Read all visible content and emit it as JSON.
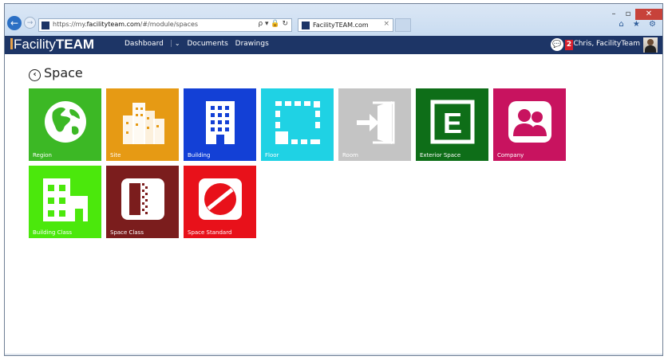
{
  "browser": {
    "url_prefix": "https://my.",
    "url_domain": "facilityteam.com",
    "url_path": "/#/module/spaces",
    "address_tools": "ρ ▾ 🔒 ↻",
    "tab_title": "FacilityTEAM.com",
    "tab_close": "×",
    "back_glyph": "←",
    "forward_glyph": "→",
    "minimize": "–",
    "maximize": "▫",
    "close": "✕",
    "right_icons": "⌂ ★ ⚙"
  },
  "header": {
    "logo_thin": "Facility",
    "logo_bold": "TEAM",
    "menu": {
      "dashboard": "Dashboard",
      "separator": "|",
      "dashboard_chevron": "⌄",
      "documents": "Documents",
      "drawings": "Drawings"
    },
    "chat_glyph": "💬",
    "notification_count": "2",
    "user_name": "Chris, FacilityTeam"
  },
  "page": {
    "back_glyph": "‹",
    "title": "Space"
  },
  "tiles": [
    {
      "label": "Region",
      "color": "#3cb825",
      "icon": "globe-icon"
    },
    {
      "label": "Site",
      "color": "#e69a14",
      "icon": "city-buildings-icon"
    },
    {
      "label": "Building",
      "color": "#1340d6",
      "icon": "building-icon"
    },
    {
      "label": "Floor",
      "color": "#1fd2e4",
      "icon": "floor-plan-icon"
    },
    {
      "label": "Room",
      "color": "#c4c4c4",
      "icon": "door-enter-icon"
    },
    {
      "label": "Exterior Space",
      "color": "#0e6e18",
      "icon": "exterior-space-icon"
    },
    {
      "label": "Company",
      "color": "#c8135f",
      "icon": "people-icon"
    },
    {
      "label": "Building Class",
      "color": "#4be80c",
      "icon": "building-class-icon"
    },
    {
      "label": "Space Class",
      "color": "#7b1d1d",
      "icon": "space-class-icon"
    },
    {
      "label": "Space Standard",
      "color": "#e8111a",
      "icon": "space-standard-icon"
    }
  ],
  "tile_icon_letter": "E"
}
